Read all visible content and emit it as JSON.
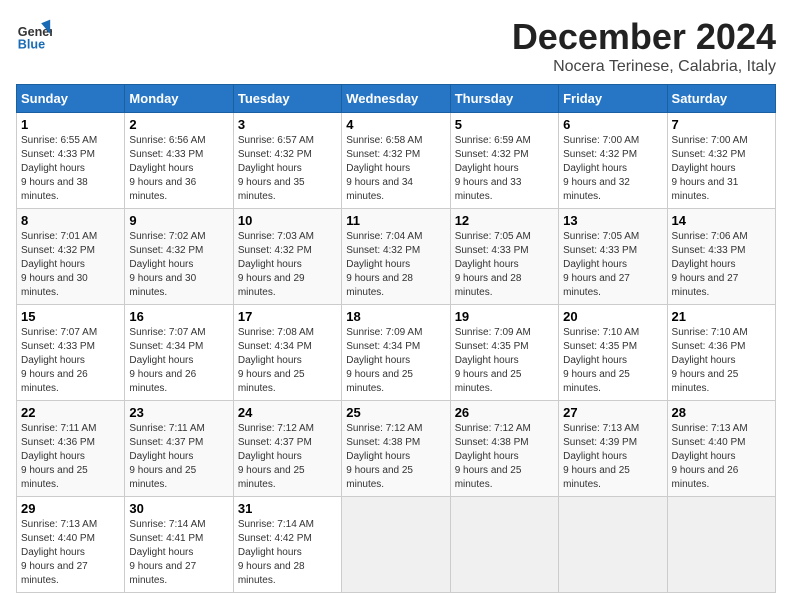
{
  "logo": {
    "line1": "General",
    "line2": "Blue"
  },
  "title": "December 2024",
  "subtitle": "Nocera Terinese, Calabria, Italy",
  "days_of_week": [
    "Sunday",
    "Monday",
    "Tuesday",
    "Wednesday",
    "Thursday",
    "Friday",
    "Saturday"
  ],
  "weeks": [
    [
      {
        "day": 1,
        "sunrise": "6:55 AM",
        "sunset": "4:33 PM",
        "daylight": "9 hours and 38 minutes."
      },
      {
        "day": 2,
        "sunrise": "6:56 AM",
        "sunset": "4:33 PM",
        "daylight": "9 hours and 36 minutes."
      },
      {
        "day": 3,
        "sunrise": "6:57 AM",
        "sunset": "4:32 PM",
        "daylight": "9 hours and 35 minutes."
      },
      {
        "day": 4,
        "sunrise": "6:58 AM",
        "sunset": "4:32 PM",
        "daylight": "9 hours and 34 minutes."
      },
      {
        "day": 5,
        "sunrise": "6:59 AM",
        "sunset": "4:32 PM",
        "daylight": "9 hours and 33 minutes."
      },
      {
        "day": 6,
        "sunrise": "7:00 AM",
        "sunset": "4:32 PM",
        "daylight": "9 hours and 32 minutes."
      },
      {
        "day": 7,
        "sunrise": "7:00 AM",
        "sunset": "4:32 PM",
        "daylight": "9 hours and 31 minutes."
      }
    ],
    [
      {
        "day": 8,
        "sunrise": "7:01 AM",
        "sunset": "4:32 PM",
        "daylight": "9 hours and 30 minutes."
      },
      {
        "day": 9,
        "sunrise": "7:02 AM",
        "sunset": "4:32 PM",
        "daylight": "9 hours and 30 minutes."
      },
      {
        "day": 10,
        "sunrise": "7:03 AM",
        "sunset": "4:32 PM",
        "daylight": "9 hours and 29 minutes."
      },
      {
        "day": 11,
        "sunrise": "7:04 AM",
        "sunset": "4:32 PM",
        "daylight": "9 hours and 28 minutes."
      },
      {
        "day": 12,
        "sunrise": "7:05 AM",
        "sunset": "4:33 PM",
        "daylight": "9 hours and 28 minutes."
      },
      {
        "day": 13,
        "sunrise": "7:05 AM",
        "sunset": "4:33 PM",
        "daylight": "9 hours and 27 minutes."
      },
      {
        "day": 14,
        "sunrise": "7:06 AM",
        "sunset": "4:33 PM",
        "daylight": "9 hours and 27 minutes."
      }
    ],
    [
      {
        "day": 15,
        "sunrise": "7:07 AM",
        "sunset": "4:33 PM",
        "daylight": "9 hours and 26 minutes."
      },
      {
        "day": 16,
        "sunrise": "7:07 AM",
        "sunset": "4:34 PM",
        "daylight": "9 hours and 26 minutes."
      },
      {
        "day": 17,
        "sunrise": "7:08 AM",
        "sunset": "4:34 PM",
        "daylight": "9 hours and 25 minutes."
      },
      {
        "day": 18,
        "sunrise": "7:09 AM",
        "sunset": "4:34 PM",
        "daylight": "9 hours and 25 minutes."
      },
      {
        "day": 19,
        "sunrise": "7:09 AM",
        "sunset": "4:35 PM",
        "daylight": "9 hours and 25 minutes."
      },
      {
        "day": 20,
        "sunrise": "7:10 AM",
        "sunset": "4:35 PM",
        "daylight": "9 hours and 25 minutes."
      },
      {
        "day": 21,
        "sunrise": "7:10 AM",
        "sunset": "4:36 PM",
        "daylight": "9 hours and 25 minutes."
      }
    ],
    [
      {
        "day": 22,
        "sunrise": "7:11 AM",
        "sunset": "4:36 PM",
        "daylight": "9 hours and 25 minutes."
      },
      {
        "day": 23,
        "sunrise": "7:11 AM",
        "sunset": "4:37 PM",
        "daylight": "9 hours and 25 minutes."
      },
      {
        "day": 24,
        "sunrise": "7:12 AM",
        "sunset": "4:37 PM",
        "daylight": "9 hours and 25 minutes."
      },
      {
        "day": 25,
        "sunrise": "7:12 AM",
        "sunset": "4:38 PM",
        "daylight": "9 hours and 25 minutes."
      },
      {
        "day": 26,
        "sunrise": "7:12 AM",
        "sunset": "4:38 PM",
        "daylight": "9 hours and 25 minutes."
      },
      {
        "day": 27,
        "sunrise": "7:13 AM",
        "sunset": "4:39 PM",
        "daylight": "9 hours and 25 minutes."
      },
      {
        "day": 28,
        "sunrise": "7:13 AM",
        "sunset": "4:40 PM",
        "daylight": "9 hours and 26 minutes."
      }
    ],
    [
      {
        "day": 29,
        "sunrise": "7:13 AM",
        "sunset": "4:40 PM",
        "daylight": "9 hours and 27 minutes."
      },
      {
        "day": 30,
        "sunrise": "7:14 AM",
        "sunset": "4:41 PM",
        "daylight": "9 hours and 27 minutes."
      },
      {
        "day": 31,
        "sunrise": "7:14 AM",
        "sunset": "4:42 PM",
        "daylight": "9 hours and 28 minutes."
      },
      null,
      null,
      null,
      null
    ]
  ]
}
